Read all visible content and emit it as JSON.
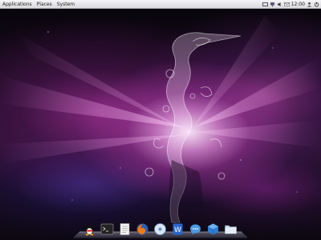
{
  "top_panel": {
    "menu_applications": "Applications",
    "menu_places": "Places",
    "menu_system": "System",
    "clock": "12:00",
    "tray_icons": [
      "keyboard-icon",
      "network-icon",
      "volume-icon",
      "mail-icon",
      "user-icon",
      "power-icon"
    ]
  },
  "dock": {
    "items": [
      {
        "name": "qq-icon"
      },
      {
        "name": "terminal-icon"
      },
      {
        "name": "text-editor-icon"
      },
      {
        "name": "firefox-icon"
      },
      {
        "name": "media-player-icon"
      },
      {
        "name": "office-writer-icon"
      },
      {
        "name": "chat-icon"
      },
      {
        "name": "virtualbox-icon"
      },
      {
        "name": "folder-icon"
      }
    ]
  },
  "colors": {
    "panel_bg": "#e6e6ea",
    "wallpaper_glow": "#f0a0e6",
    "wallpaper_purple": "#b43cb0",
    "wallpaper_blue": "#4636b4"
  }
}
